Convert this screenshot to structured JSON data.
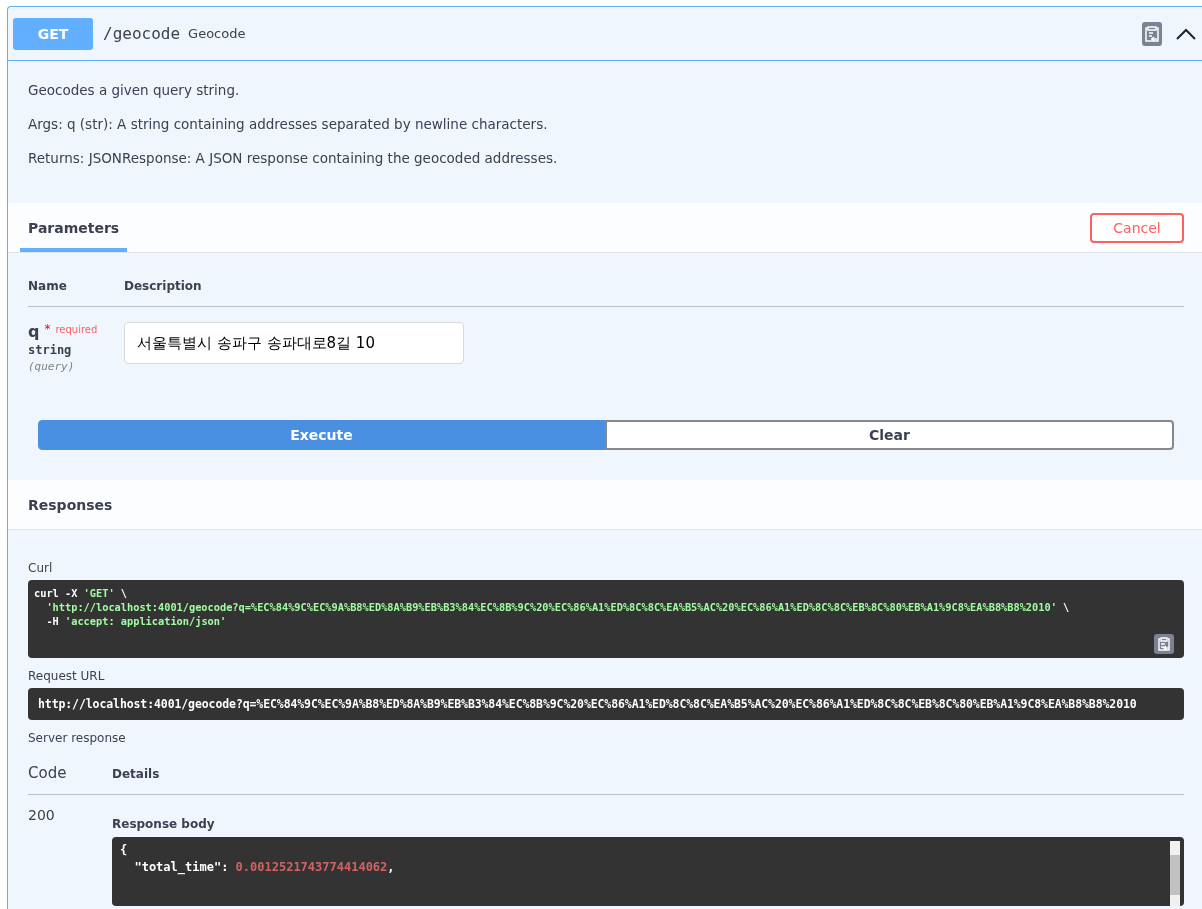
{
  "operation": {
    "method": "GET",
    "path": "/geocode",
    "summary": "Geocode"
  },
  "description": [
    "Geocodes a given query string.",
    "Args: q (str): A string containing addresses separated by newline characters.",
    "Returns: JSONResponse: A JSON response containing the geocoded addresses."
  ],
  "parameters": {
    "title": "Parameters",
    "cancel": "Cancel",
    "columns": [
      "Name",
      "Description"
    ],
    "items": [
      {
        "name": "q",
        "required_mark": "*",
        "required_label": "required",
        "type": "string",
        "location": "(query)",
        "value": "서울특별시 송파구 송파대로8길 10"
      }
    ]
  },
  "actions": {
    "execute": "Execute",
    "clear": "Clear"
  },
  "responses": {
    "title": "Responses",
    "curl": {
      "label": "Curl",
      "lines": [
        {
          "indent": false,
          "segments": [
            {
              "kind": "plain",
              "text": "curl -X "
            },
            {
              "kind": "string",
              "text": "'GET'"
            },
            {
              "kind": "plain",
              "text": " \\"
            }
          ]
        },
        {
          "indent": true,
          "segments": [
            {
              "kind": "string",
              "text": "'http://localhost:4001/geocode?q=%EC%84%9C%EC%9A%B8%ED%8A%B9%EB%B3%84%EC%8B%9C%20%EC%86%A1%ED%8C%8C%EA%B5%AC%20%EC%86%A1%ED%8C%8C%EB%8C%80%EB%A1%9C8%EA%B8%B8%2010'"
            },
            {
              "kind": "plain",
              "text": " \\"
            }
          ]
        },
        {
          "indent": true,
          "segments": [
            {
              "kind": "plain",
              "text": "-H "
            },
            {
              "kind": "string",
              "text": "'accept: application/json'"
            }
          ]
        }
      ]
    },
    "request_url": {
      "label": "Request URL",
      "value": "http://localhost:4001/geocode?q=%EC%84%9C%EC%9A%B8%ED%8A%B9%EB%B3%84%EC%8B%9C%20%EC%86%A1%ED%8C%8C%EA%B5%AC%20%EC%86%A1%ED%8C%8C%EB%8C%80%EB%A1%9C8%EA%B8%B8%2010"
    },
    "server_response": {
      "label": "Server response",
      "columns": [
        "Code",
        "Details"
      ],
      "code": "200",
      "body_label": "Response body",
      "body_lines": [
        [
          {
            "kind": "plain",
            "text": "{"
          }
        ],
        [
          {
            "kind": "plain",
            "text": "  \"total_time\": "
          },
          {
            "kind": "number",
            "text": "0.0012521743774414062"
          },
          {
            "kind": "plain",
            "text": ","
          }
        ]
      ]
    }
  }
}
